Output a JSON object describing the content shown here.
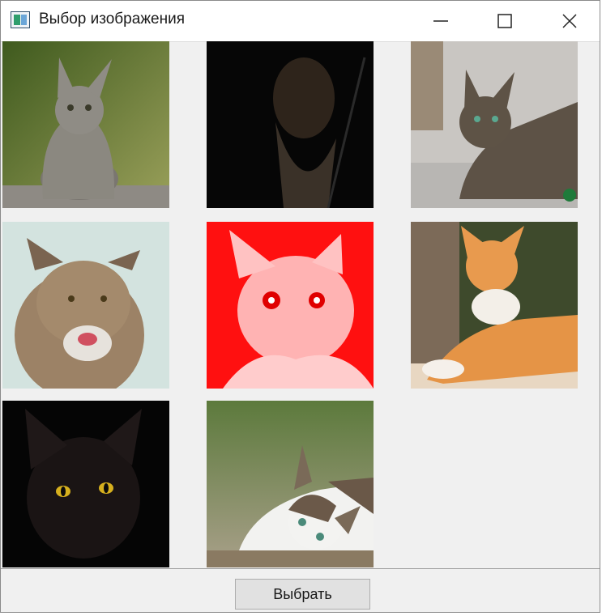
{
  "window": {
    "title": "Выбор изображения",
    "controls": [
      "minimize-icon",
      "maximize-icon",
      "close-icon"
    ]
  },
  "gallery": {
    "images": [
      {
        "name": "tabby-cat-sitting",
        "colors": [
          "#5a6b2a",
          "#8a8a80"
        ]
      },
      {
        "name": "bearded-man-dark",
        "colors": [
          "#0a0a0a",
          "#3a2e22"
        ]
      },
      {
        "name": "tabby-cat-lying",
        "colors": [
          "#c8c8c8",
          "#5a4a3a"
        ]
      },
      {
        "name": "fluffy-cat-hissing",
        "colors": [
          "#cfe1dc",
          "#8a6a4a"
        ]
      },
      {
        "name": "white-cat-red-tint",
        "colors": [
          "#ff0000",
          "#ffd0d0"
        ]
      },
      {
        "name": "orange-cat-lying",
        "colors": [
          "#3a4a2a",
          "#e08a3a"
        ]
      },
      {
        "name": "black-cat",
        "colors": [
          "#050505",
          "#d8b020"
        ]
      },
      {
        "name": "white-tabby-cat-lying",
        "colors": [
          "#6a8a4a",
          "#f0f0f0"
        ]
      }
    ]
  },
  "footer": {
    "select_label": "Выбрать"
  }
}
